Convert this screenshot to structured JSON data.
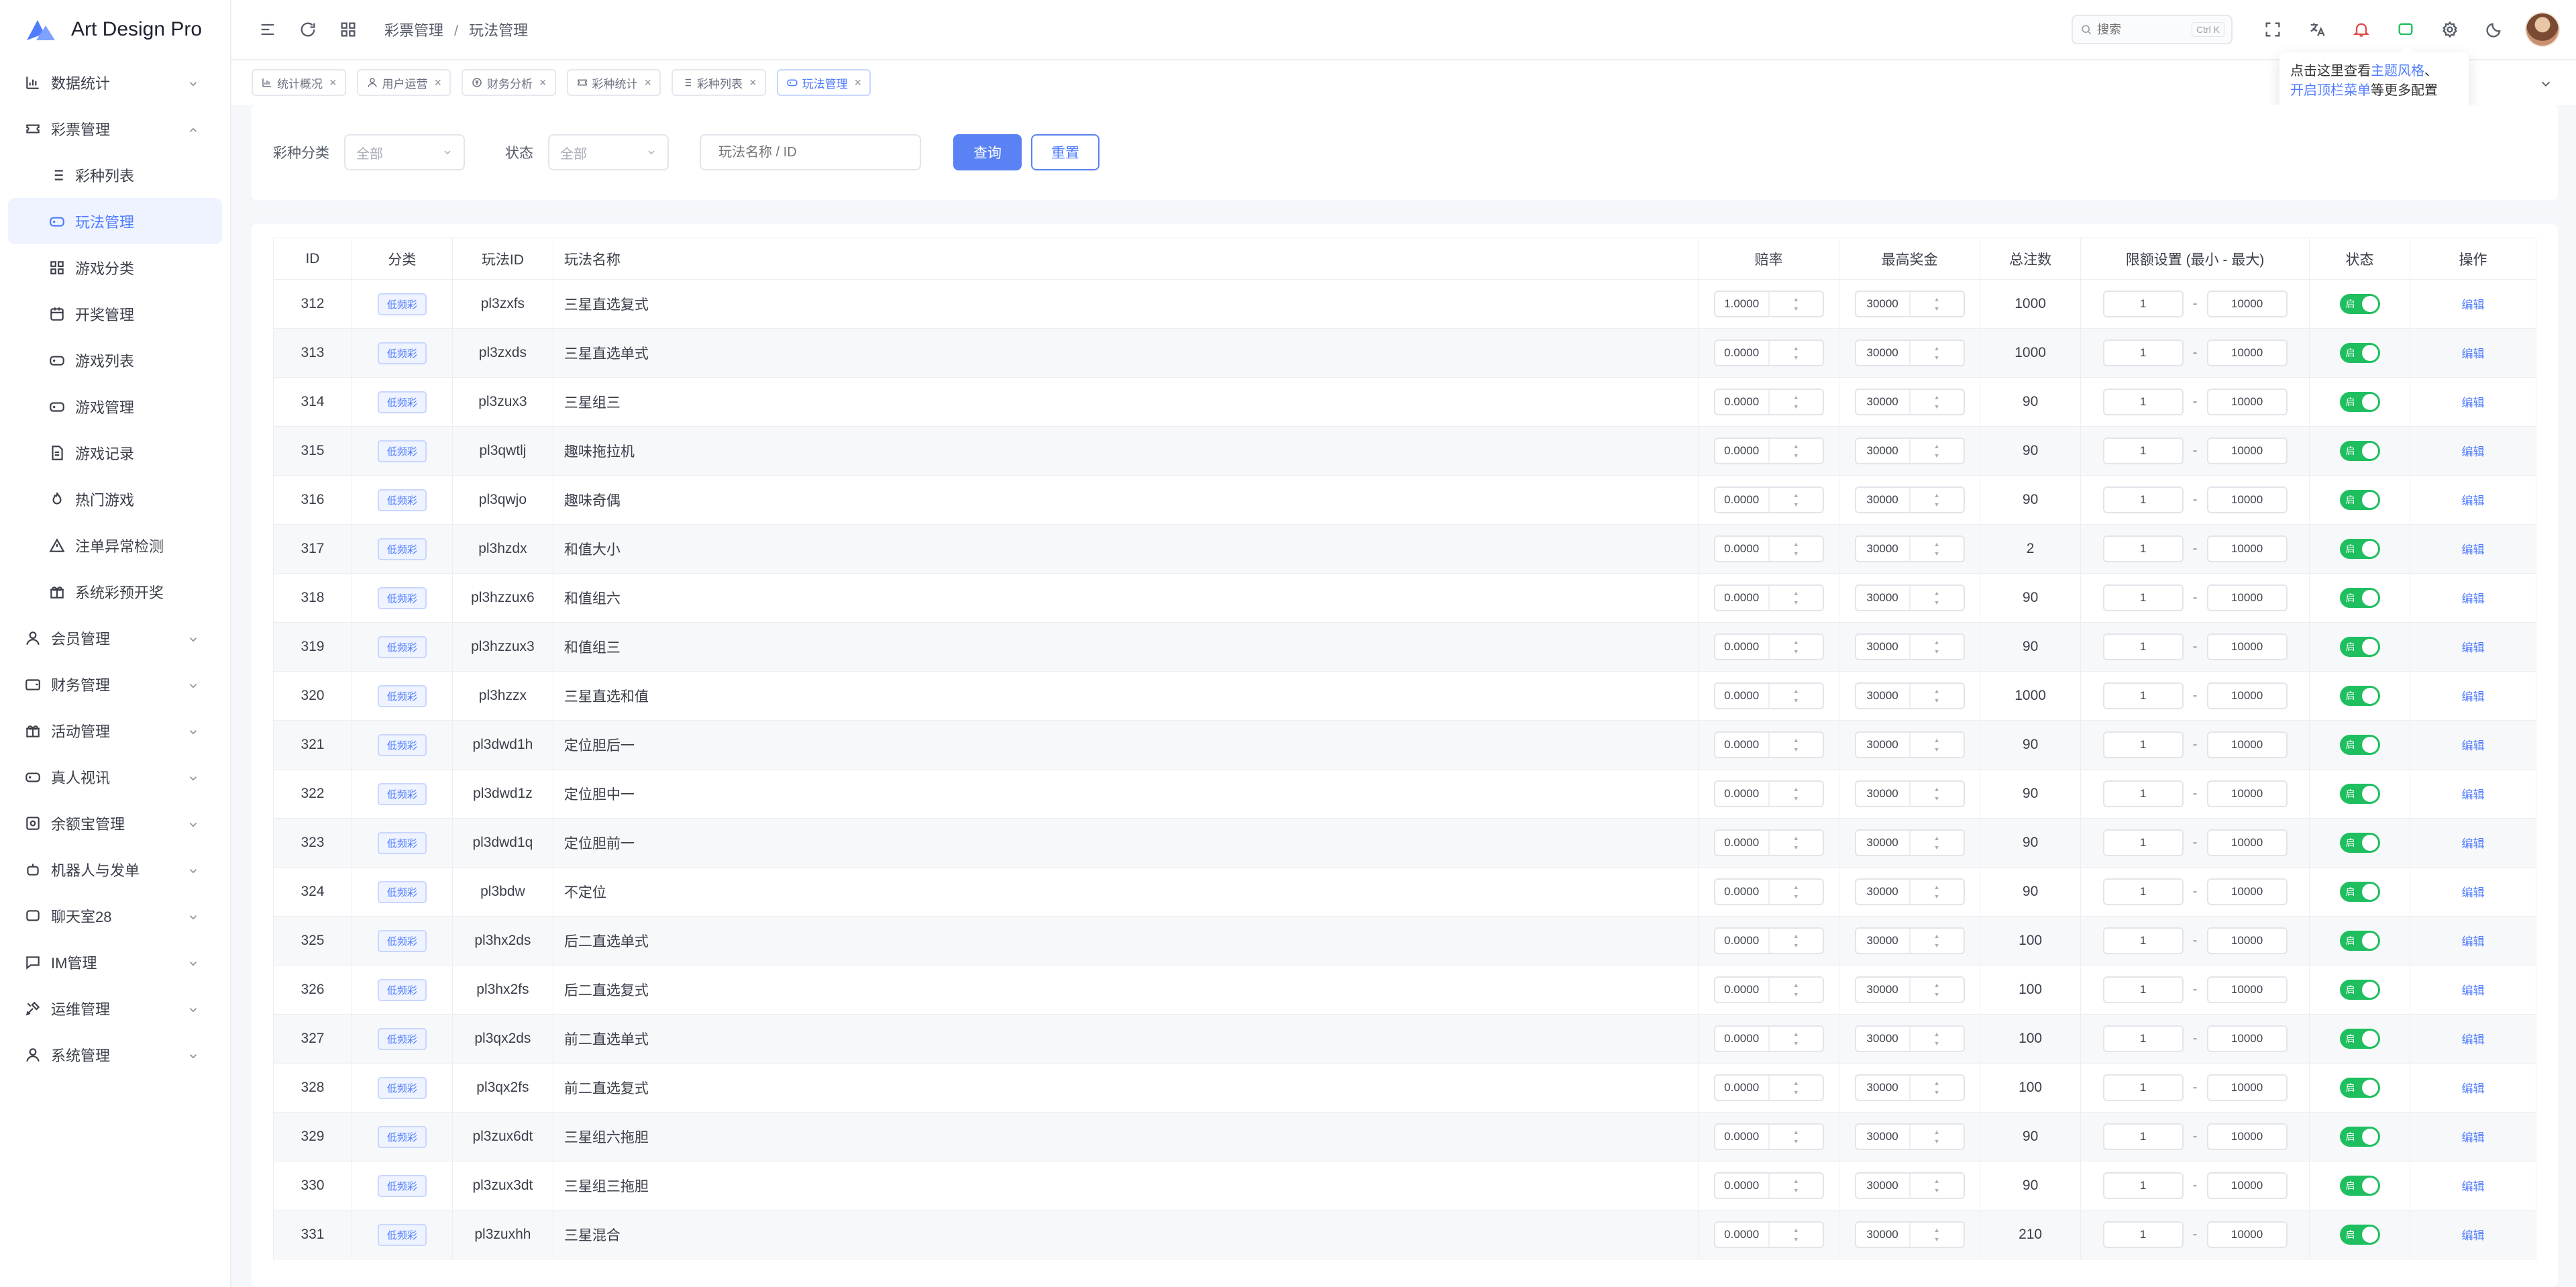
{
  "app": {
    "name": "Art Design Pro"
  },
  "sidebar": {
    "items": [
      {
        "label": "数据统计",
        "icon": "bar-chart-icon",
        "expandable": true,
        "expanded": false,
        "level": 0
      },
      {
        "label": "彩票管理",
        "icon": "ticket-icon",
        "expandable": true,
        "expanded": true,
        "level": 0
      },
      {
        "label": "彩种列表",
        "icon": "list-icon",
        "level": 1
      },
      {
        "label": "玩法管理",
        "icon": "gamepad-icon",
        "level": 1,
        "active": true
      },
      {
        "label": "游戏分类",
        "icon": "grid-icon",
        "level": 1
      },
      {
        "label": "开奖管理",
        "icon": "calendar-icon",
        "level": 1
      },
      {
        "label": "游戏列表",
        "icon": "gamepad-icon",
        "level": 1
      },
      {
        "label": "游戏管理",
        "icon": "gamepad-icon",
        "level": 1
      },
      {
        "label": "游戏记录",
        "icon": "document-icon",
        "level": 1
      },
      {
        "label": "热门游戏",
        "icon": "fire-icon",
        "level": 1
      },
      {
        "label": "注单异常检测",
        "icon": "alert-icon",
        "level": 1
      },
      {
        "label": "系统彩预开奖",
        "icon": "gift-icon",
        "level": 1
      },
      {
        "label": "会员管理",
        "icon": "user-icon",
        "expandable": true,
        "level": 0
      },
      {
        "label": "财务管理",
        "icon": "wallet-icon",
        "expandable": true,
        "level": 0
      },
      {
        "label": "活动管理",
        "icon": "gift-icon",
        "expandable": true,
        "level": 0
      },
      {
        "label": "真人视讯",
        "icon": "gamepad-icon",
        "expandable": true,
        "level": 0
      },
      {
        "label": "余额宝管理",
        "icon": "safe-icon",
        "expandable": true,
        "level": 0
      },
      {
        "label": "机器人与发单",
        "icon": "robot-icon",
        "expandable": true,
        "level": 0
      },
      {
        "label": "聊天室28",
        "icon": "chat-icon",
        "expandable": true,
        "level": 0
      },
      {
        "label": "IM管理",
        "icon": "message-icon",
        "expandable": true,
        "level": 0
      },
      {
        "label": "运维管理",
        "icon": "tools-icon",
        "expandable": true,
        "level": 0
      },
      {
        "label": "系统管理",
        "icon": "user-icon",
        "expandable": true,
        "level": 0
      }
    ]
  },
  "header": {
    "breadcrumb": [
      "彩票管理",
      "玩法管理"
    ],
    "search": {
      "placeholder": "搜索",
      "shortcut": "Ctrl K"
    }
  },
  "tabs": [
    {
      "label": "统计概况",
      "icon": "bar-chart-icon"
    },
    {
      "label": "用户运营",
      "icon": "user-icon"
    },
    {
      "label": "财务分析",
      "icon": "finance-icon"
    },
    {
      "label": "彩种统计",
      "icon": "ticket-icon"
    },
    {
      "label": "彩种列表",
      "icon": "list-icon"
    },
    {
      "label": "玩法管理",
      "icon": "gamepad-icon",
      "active": true
    }
  ],
  "tooltip": {
    "line1_prefix": "点击这里查看",
    "link1": "主题风格",
    "sep": "、",
    "link2": "开启顶栏菜单",
    "line2_suffix": "等更多配置"
  },
  "filter": {
    "category_label": "彩种分类",
    "category_value": "全部",
    "status_label": "状态",
    "status_value": "全部",
    "keyword_placeholder": "玩法名称 / ID",
    "query_label": "查询",
    "reset_label": "重置"
  },
  "table": {
    "columns": [
      "ID",
      "分类",
      "玩法ID",
      "玩法名称",
      "赔率",
      "最高奖金",
      "总注数",
      "限额设置 (最小 - 最大)",
      "状态",
      "操作"
    ],
    "rows": [
      {
        "id": "312",
        "cat": "低频彩",
        "code": "pl3zxfs",
        "name": "三星直选复式",
        "odds": "1.0000",
        "max": "30000",
        "total": "1000",
        "min_limit": "1",
        "max_limit": "10000"
      },
      {
        "id": "313",
        "cat": "低频彩",
        "code": "pl3zxds",
        "name": "三星直选单式",
        "odds": "0.0000",
        "max": "30000",
        "total": "1000",
        "min_limit": "1",
        "max_limit": "10000"
      },
      {
        "id": "314",
        "cat": "低频彩",
        "code": "pl3zux3",
        "name": "三星组三",
        "odds": "0.0000",
        "max": "30000",
        "total": "90",
        "min_limit": "1",
        "max_limit": "10000"
      },
      {
        "id": "315",
        "cat": "低频彩",
        "code": "pl3qwtlj",
        "name": "趣味拖拉机",
        "odds": "0.0000",
        "max": "30000",
        "total": "90",
        "min_limit": "1",
        "max_limit": "10000"
      },
      {
        "id": "316",
        "cat": "低频彩",
        "code": "pl3qwjo",
        "name": "趣味奇偶",
        "odds": "0.0000",
        "max": "30000",
        "total": "90",
        "min_limit": "1",
        "max_limit": "10000"
      },
      {
        "id": "317",
        "cat": "低频彩",
        "code": "pl3hzdx",
        "name": "和值大小",
        "odds": "0.0000",
        "max": "30000",
        "total": "2",
        "min_limit": "1",
        "max_limit": "10000"
      },
      {
        "id": "318",
        "cat": "低频彩",
        "code": "pl3hzzux6",
        "name": "和值组六",
        "odds": "0.0000",
        "max": "30000",
        "total": "90",
        "min_limit": "1",
        "max_limit": "10000"
      },
      {
        "id": "319",
        "cat": "低频彩",
        "code": "pl3hzzux3",
        "name": "和值组三",
        "odds": "0.0000",
        "max": "30000",
        "total": "90",
        "min_limit": "1",
        "max_limit": "10000"
      },
      {
        "id": "320",
        "cat": "低频彩",
        "code": "pl3hzzx",
        "name": "三星直选和值",
        "odds": "0.0000",
        "max": "30000",
        "total": "1000",
        "min_limit": "1",
        "max_limit": "10000"
      },
      {
        "id": "321",
        "cat": "低频彩",
        "code": "pl3dwd1h",
        "name": "定位胆后一",
        "odds": "0.0000",
        "max": "30000",
        "total": "90",
        "min_limit": "1",
        "max_limit": "10000"
      },
      {
        "id": "322",
        "cat": "低频彩",
        "code": "pl3dwd1z",
        "name": "定位胆中一",
        "odds": "0.0000",
        "max": "30000",
        "total": "90",
        "min_limit": "1",
        "max_limit": "10000"
      },
      {
        "id": "323",
        "cat": "低频彩",
        "code": "pl3dwd1q",
        "name": "定位胆前一",
        "odds": "0.0000",
        "max": "30000",
        "total": "90",
        "min_limit": "1",
        "max_limit": "10000"
      },
      {
        "id": "324",
        "cat": "低频彩",
        "code": "pl3bdw",
        "name": "不定位",
        "odds": "0.0000",
        "max": "30000",
        "total": "90",
        "min_limit": "1",
        "max_limit": "10000"
      },
      {
        "id": "325",
        "cat": "低频彩",
        "code": "pl3hx2ds",
        "name": "后二直选单式",
        "odds": "0.0000",
        "max": "30000",
        "total": "100",
        "min_limit": "1",
        "max_limit": "10000"
      },
      {
        "id": "326",
        "cat": "低频彩",
        "code": "pl3hx2fs",
        "name": "后二直选复式",
        "odds": "0.0000",
        "max": "30000",
        "total": "100",
        "min_limit": "1",
        "max_limit": "10000"
      },
      {
        "id": "327",
        "cat": "低频彩",
        "code": "pl3qx2ds",
        "name": "前二直选单式",
        "odds": "0.0000",
        "max": "30000",
        "total": "100",
        "min_limit": "1",
        "max_limit": "10000"
      },
      {
        "id": "328",
        "cat": "低频彩",
        "code": "pl3qx2fs",
        "name": "前二直选复式",
        "odds": "0.0000",
        "max": "30000",
        "total": "100",
        "min_limit": "1",
        "max_limit": "10000"
      },
      {
        "id": "329",
        "cat": "低频彩",
        "code": "pl3zux6dt",
        "name": "三星组六拖胆",
        "odds": "0.0000",
        "max": "30000",
        "total": "90",
        "min_limit": "1",
        "max_limit": "10000"
      },
      {
        "id": "330",
        "cat": "低频彩",
        "code": "pl3zux3dt",
        "name": "三星组三拖胆",
        "odds": "0.0000",
        "max": "30000",
        "total": "90",
        "min_limit": "1",
        "max_limit": "10000"
      },
      {
        "id": "331",
        "cat": "低频彩",
        "code": "pl3zuxhh",
        "name": "三星混合",
        "odds": "0.0000",
        "max": "30000",
        "total": "210",
        "min_limit": "1",
        "max_limit": "10000"
      }
    ],
    "status_on_label": "启",
    "edit_label": "编辑"
  },
  "colors": {
    "accent": "#4f7cff",
    "switch_on": "#1fbf5f"
  }
}
